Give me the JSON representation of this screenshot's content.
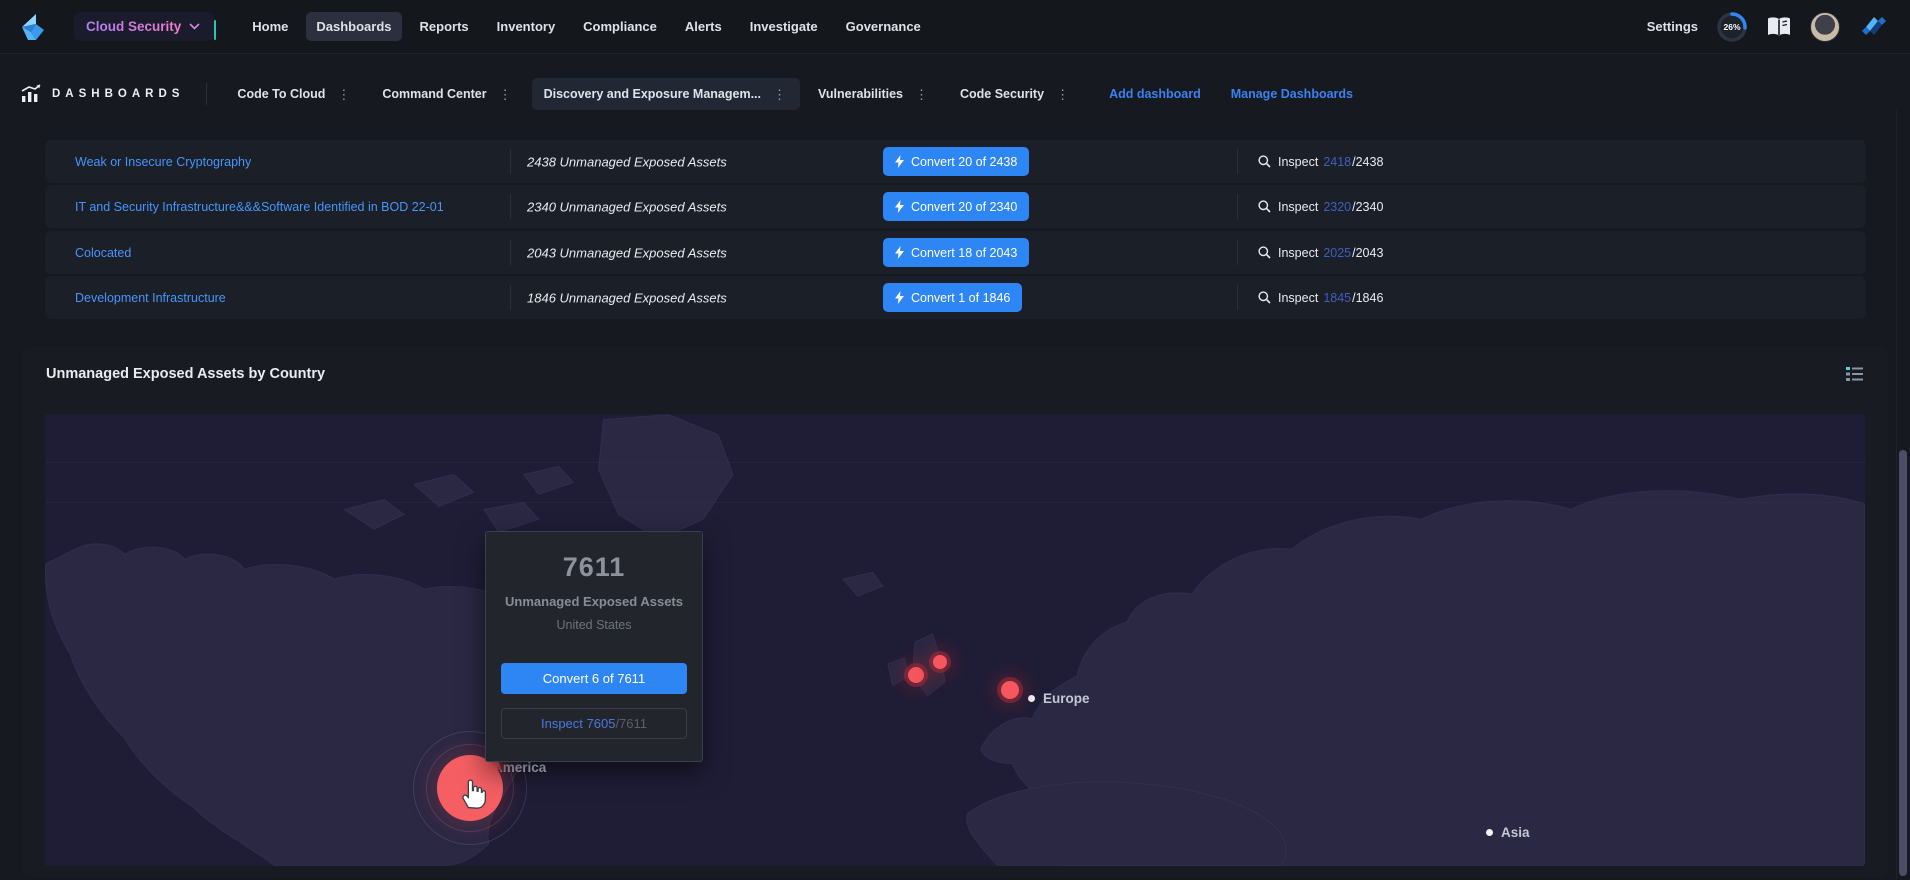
{
  "icons": {
    "kebab": "⋮"
  },
  "topnav": {
    "product": "Cloud Security",
    "items": [
      "Home",
      "Dashboards",
      "Reports",
      "Inventory",
      "Compliance",
      "Alerts",
      "Investigate",
      "Governance"
    ],
    "active_item": "Dashboards",
    "settings_label": "Settings",
    "license_progress": "26%"
  },
  "dashbar": {
    "title": "DASHBOARDS",
    "tabs": [
      {
        "label": "Code To Cloud"
      },
      {
        "label": "Command Center"
      },
      {
        "label": "Discovery and Exposure Managem..."
      },
      {
        "label": "Vulnerabilities"
      },
      {
        "label": "Code Security"
      }
    ],
    "active_tab": "Discovery and Exposure Managem...",
    "add_dashboard_label": "Add dashboard",
    "manage_dashboards_label": "Manage Dashboards"
  },
  "issues_table": {
    "rows": [
      {
        "name": "Weak or Insecure Cryptography",
        "count": "2438 Unmanaged Exposed Assets",
        "convert": "Convert 20 of 2438",
        "inspect": {
          "label": "Inspect",
          "done": "2418",
          "total": "/2438"
        }
      },
      {
        "name": "IT and Security Infrastructure&&&Software Identified in BOD 22-01",
        "count": "2340 Unmanaged Exposed Assets",
        "convert": "Convert 20 of 2340",
        "inspect": {
          "label": "Inspect",
          "done": "2320",
          "total": "/2340"
        }
      },
      {
        "name": "Colocated",
        "count": "2043 Unmanaged Exposed Assets",
        "convert": "Convert 18 of 2043",
        "inspect": {
          "label": "Inspect",
          "done": "2025",
          "total": "/2043"
        }
      },
      {
        "name": "Development Infrastructure",
        "count": "1846 Unmanaged Exposed Assets",
        "convert": "Convert 1 of 1846",
        "inspect": {
          "label": "Inspect",
          "done": "1845",
          "total": "/1846"
        }
      }
    ]
  },
  "map_widget": {
    "title": "Unmanaged Exposed Assets by Country",
    "region_labels": {
      "europe": "Europe",
      "asia": "Asia",
      "america": "America"
    },
    "tooltip": {
      "value": "7611",
      "metric": "Unmanaged Exposed Assets",
      "country": "United States",
      "convert": "Convert 6 of 7611",
      "inspect_done": "Inspect 7605",
      "inspect_total": "/7611"
    }
  },
  "colors": {
    "accent_blue": "#2e86f5",
    "link_blue": "#4695fc",
    "marker_red": "#f4585e",
    "map_land": "#2a2843",
    "map_ocean": "#1f1d36"
  }
}
